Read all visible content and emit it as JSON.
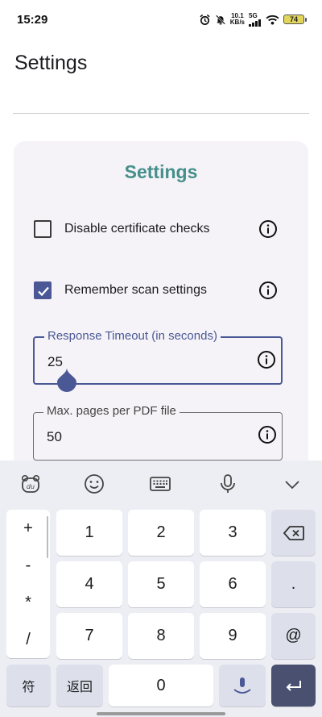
{
  "status_bar": {
    "time": "15:29",
    "network_speed_value": "10.1",
    "network_speed_unit": "KB/s",
    "network_type": "5G",
    "battery_level": "74",
    "icons": [
      "alarm-icon",
      "mute-icon",
      "signal-icon",
      "wifi-icon",
      "battery-icon"
    ]
  },
  "app_bar": {
    "title": "Settings"
  },
  "card": {
    "title": "Settings",
    "options": [
      {
        "label": "Disable certificate checks",
        "checked": false,
        "icon": "info-icon"
      },
      {
        "label": "Remember scan settings",
        "checked": true,
        "icon": "info-icon"
      }
    ],
    "fields": [
      {
        "label": "Response Timeout (in seconds)",
        "value": "25",
        "focused": true,
        "icon": "info-icon"
      },
      {
        "label": "Max. pages per PDF file",
        "value": "50",
        "focused": false,
        "icon": "info-icon"
      }
    ]
  },
  "keyboard": {
    "toolbar_icons": [
      "du-logo-icon",
      "emoji-icon",
      "keyboard-icon",
      "microphone-icon",
      "chevron-down-icon"
    ],
    "symbols": [
      "+",
      "-",
      "*",
      "/"
    ],
    "digits_row1": [
      "1",
      "2",
      "3"
    ],
    "digits_row2": [
      "4",
      "5",
      "6"
    ],
    "digits_row3": [
      "7",
      "8",
      "9"
    ],
    "dot": ".",
    "at": "@",
    "fu": "符",
    "back": "返回",
    "zero": "0",
    "accent_color": "#4a5896",
    "title_color": "#468f8a"
  }
}
